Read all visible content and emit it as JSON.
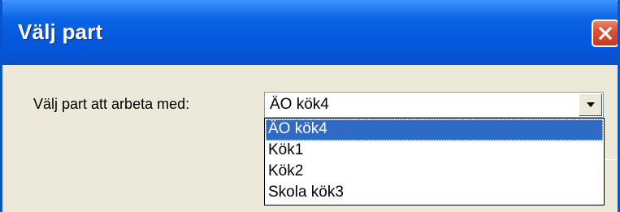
{
  "window": {
    "title": "Välj part"
  },
  "form": {
    "label": "Välj part att arbeta med:",
    "selected_value": "ÄO kök4"
  },
  "dropdown": {
    "options": [
      "ÄO kök4",
      "Kök1",
      "Kök2",
      "Skola kök3"
    ],
    "highlighted_index": 0
  },
  "icons": {
    "close": "close-icon",
    "dropdown_arrow": "chevron-down-icon"
  },
  "colors": {
    "titlebar": "#0659dc",
    "selection": "#316ac5",
    "close_button": "#d7543a",
    "dialog_bg": "#ece9d8"
  }
}
